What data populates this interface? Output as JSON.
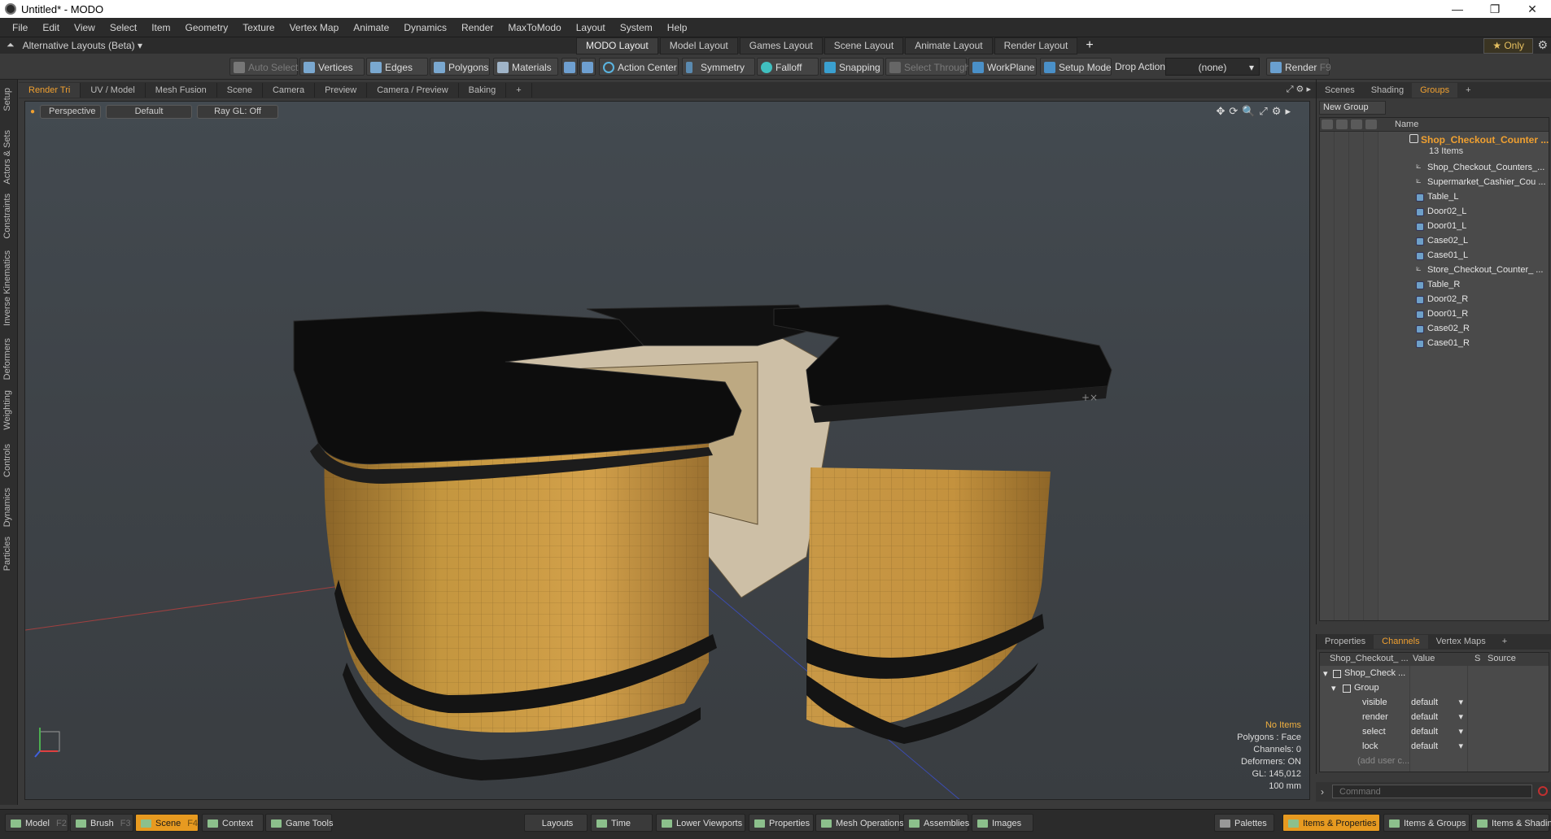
{
  "window": {
    "title": "Untitled* - MODO",
    "controls": [
      "—",
      "❐",
      "✕"
    ]
  },
  "menu": [
    "File",
    "Edit",
    "View",
    "Select",
    "Item",
    "Geometry",
    "Texture",
    "Vertex Map",
    "Animate",
    "Dynamics",
    "Render",
    "MaxToModo",
    "Layout",
    "System",
    "Help"
  ],
  "layout_bar": {
    "alt_layouts": "Alternative Layouts (Beta) ▾",
    "tabs": [
      "MODO Layout",
      "Model Layout",
      "Games Layout",
      "Scene Layout",
      "Animate Layout",
      "Render Layout"
    ],
    "active_tab": "MODO Layout",
    "add": "+",
    "only": "★  Only"
  },
  "toolbar": {
    "auto_select": "Auto Select",
    "vertices": "Vertices",
    "edges": "Edges",
    "polygons": "Polygons",
    "materials": "Materials",
    "action_center": "Action Center",
    "symmetry": "Symmetry",
    "falloff": "Falloff",
    "snapping": "Snapping",
    "select_through": "Select Through",
    "workplane": "WorkPlane",
    "setup_mode": "Setup Mode",
    "drop_action_label": "Drop Action",
    "drop_action_value": "(none)",
    "render": "Render",
    "render_key": "F9"
  },
  "left_tabs": [
    "Setup",
    "Actors & Sets",
    "Constraints",
    "Inverse Kinematics",
    "Deformers",
    "Weighting",
    "Controls",
    "Dynamics",
    "Particles"
  ],
  "viewport_tabs": [
    "Render Tri",
    "UV / Model",
    "Mesh Fusion",
    "Scene",
    "Camera",
    "Preview",
    "Camera / Preview",
    "Baking",
    "+"
  ],
  "viewport": {
    "view": "Perspective",
    "shading": "Default",
    "raygl": "Ray GL: Off",
    "info": {
      "items": "No Items",
      "polygons": "Polygons : Face",
      "channels": "Channels: 0",
      "deformers": "Deformers: ON",
      "gl": "GL: 145,012",
      "scale": "100 mm"
    }
  },
  "right_panel": {
    "tabs": [
      "Scenes",
      "Shading",
      "Groups",
      "+"
    ],
    "active_tab": "Groups",
    "new_group": "New Group",
    "name_header": "Name",
    "group_name": "Shop_Checkout_Counter ...",
    "group_count": "13 Items",
    "items": [
      {
        "label": "Shop_Checkout_Counters_...",
        "type": "locator"
      },
      {
        "label": "Supermarket_Cashier_Cou ...",
        "type": "locator"
      },
      {
        "label": "Table_L",
        "type": "mesh"
      },
      {
        "label": "Door02_L",
        "type": "mesh"
      },
      {
        "label": "Door01_L",
        "type": "mesh"
      },
      {
        "label": "Case02_L",
        "type": "mesh"
      },
      {
        "label": "Case01_L",
        "type": "mesh"
      },
      {
        "label": "Store_Checkout_Counter_ ...",
        "type": "locator"
      },
      {
        "label": "Table_R",
        "type": "mesh"
      },
      {
        "label": "Door02_R",
        "type": "mesh"
      },
      {
        "label": "Door01_R",
        "type": "mesh"
      },
      {
        "label": "Case02_R",
        "type": "mesh"
      },
      {
        "label": "Case01_R",
        "type": "mesh"
      }
    ]
  },
  "channels_panel": {
    "tabs": [
      "Properties",
      "Channels",
      "Vertex Maps",
      "+"
    ],
    "active_tab": "Channels",
    "headers": {
      "name": "Shop_Checkout_ ...",
      "value": "Value",
      "s": "S",
      "source": "Source"
    },
    "tree_root": "Shop_Check ...",
    "tree_group": "Group",
    "rows": [
      {
        "name": "visible",
        "value": "default"
      },
      {
        "name": "render",
        "value": "default"
      },
      {
        "name": "select",
        "value": "default"
      },
      {
        "name": "lock",
        "value": "default"
      }
    ],
    "add_user": "(add user c..."
  },
  "command": {
    "placeholder": "Command"
  },
  "bottom_bar": {
    "model": "Model",
    "model_key": "F2",
    "brush": "Brush",
    "brush_key": "F3",
    "scene": "Scene",
    "scene_key": "F4",
    "context": "Context",
    "game_tools": "Game Tools",
    "layouts": "Layouts",
    "time": "Time",
    "lower_viewports": "Lower Viewports",
    "properties": "Properties",
    "mesh_operations": "Mesh Operations",
    "assemblies": "Assemblies",
    "images": "Images",
    "palettes": "Palettes",
    "items_properties": "Items & Properties",
    "items_groups": "Items & Groups",
    "items_shading": "Items & Shading"
  },
  "colors": {
    "accent": "#f0a030",
    "active_bottom": "#e79a20",
    "counter_wood": "#b98a3e",
    "counter_top": "#0d0d0d"
  }
}
